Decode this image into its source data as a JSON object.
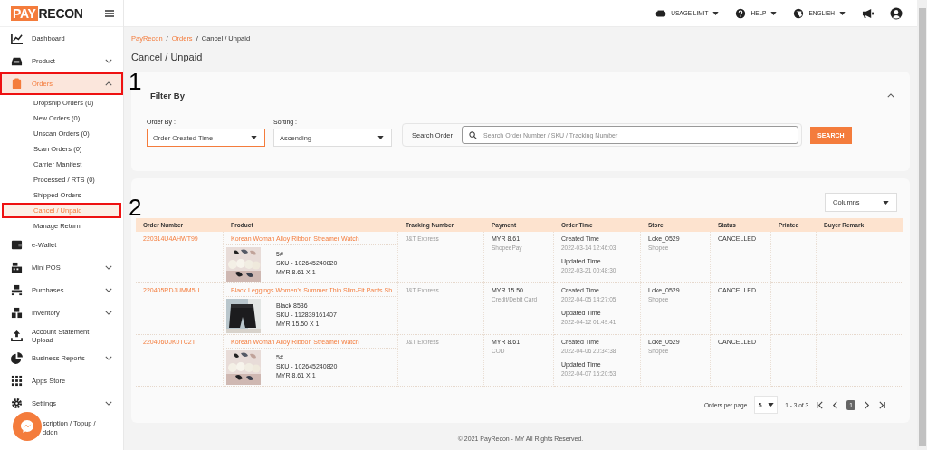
{
  "logo": {
    "part1": "PAY",
    "part2": "RECON"
  },
  "header": {
    "menus": [
      {
        "label": "USAGE LIMIT"
      },
      {
        "label": "HELP"
      },
      {
        "label": "ENGLISH"
      }
    ]
  },
  "sidebar": {
    "items": [
      {
        "label": "Dashboard",
        "selected": false,
        "highlighted": false
      },
      {
        "label": "Product",
        "expanded": false,
        "selected": false,
        "highlighted": false
      },
      {
        "label": "Orders",
        "expanded": true,
        "selected": true,
        "highlighted": true,
        "children": [
          {
            "label": "Dropship Orders (0)",
            "selected": false,
            "highlighted": false
          },
          {
            "label": "New Orders (0)",
            "selected": false,
            "highlighted": false
          },
          {
            "label": "Unscan Orders (0)",
            "selected": false,
            "highlighted": false
          },
          {
            "label": "Scan Orders (0)",
            "selected": false,
            "highlighted": false
          },
          {
            "label": "Carrier Manifest",
            "selected": false,
            "highlighted": false
          },
          {
            "label": "Processed / RTS (0)",
            "selected": false,
            "highlighted": false
          },
          {
            "label": "Shipped Orders",
            "selected": false,
            "highlighted": false
          },
          {
            "label": "Cancel / Unpaid",
            "selected": true,
            "highlighted": true
          },
          {
            "label": "Manage Return",
            "selected": false,
            "highlighted": false
          }
        ]
      },
      {
        "label": "e-Wallet",
        "selected": false,
        "highlighted": false
      },
      {
        "label": "Mini POS",
        "expanded": false,
        "selected": false,
        "highlighted": false
      },
      {
        "label": "Purchases",
        "expanded": false,
        "selected": false,
        "highlighted": false
      },
      {
        "label": "Inventory",
        "expanded": false,
        "selected": false,
        "highlighted": false
      },
      {
        "label": "Account Statement Upload",
        "selected": false,
        "highlighted": false
      },
      {
        "label": "Business Reports",
        "expanded": false,
        "selected": false,
        "highlighted": false
      },
      {
        "label": "Apps Store",
        "selected": false,
        "highlighted": false
      },
      {
        "label": "Settings",
        "expanded": false,
        "selected": false,
        "highlighted": false
      },
      {
        "label": "scription / Topup / ddon",
        "selected": false,
        "highlighted": false
      }
    ]
  },
  "breadcrumb": [
    {
      "label": "PayRecon",
      "kind": "link"
    },
    {
      "label": "/",
      "kind": "separator"
    },
    {
      "label": "Orders",
      "kind": "link"
    },
    {
      "label": "/",
      "kind": "separator"
    },
    {
      "label": "Cancel / Unpaid",
      "kind": "current"
    }
  ],
  "page_title": "Cancel / Unpaid",
  "filter": {
    "annotation": "1",
    "title": "Filter By",
    "order_by": {
      "label": "Order By :",
      "value": "Order Created Time"
    },
    "sorting": {
      "label": "Sorting :",
      "value": "Ascending"
    },
    "search": {
      "label": "Search Order",
      "placeholder": "Search Order Number / SKU / Tracking Number"
    },
    "search_button": "SEARCH"
  },
  "table": {
    "annotation": "2",
    "columns_button": "Columns",
    "columns": [
      "Order Number",
      "Product",
      "Tracking Number",
      "Payment",
      "Order Time",
      "Store",
      "Status",
      "Printed",
      "Buyer Remark"
    ],
    "rows": [
      {
        "order_number": "220314U4AHWT99",
        "product": {
          "title": "Korean Woman Alloy Ribbon Streamer Watch",
          "variant": "5#",
          "sku": "SKU - 102645240820",
          "price": "MYR 8.61 X 1"
        },
        "tracking": "J&T Express",
        "payment": {
          "amount": "MYR 8.61",
          "method": "ShopeePay"
        },
        "order_time": {
          "created_label": "Created Time",
          "created": "2022-03-14 12:46:03",
          "updated_label": "Updated Time",
          "updated": "2022-03-21 00:48:30"
        },
        "store": {
          "name": "Loke_0529",
          "platform": "Shopee"
        },
        "status": "CANCELLED"
      },
      {
        "order_number": "220405RDJUMM5U",
        "product": {
          "title": "Black Leggings Women's Summer Thin Slim-Fit Pants Sh",
          "variant": "Black 8536",
          "sku": "SKU - 112839161407",
          "price": "MYR 15.50 X 1"
        },
        "tracking": "J&T Express",
        "payment": {
          "amount": "MYR 15.50",
          "method": "Credit/Debit Card"
        },
        "order_time": {
          "created_label": "Created Time",
          "created": "2022-04-05 14:27:05",
          "updated_label": "Updated Time",
          "updated": "2022-04-12 01:49:41"
        },
        "store": {
          "name": "Loke_0529",
          "platform": "Shopee"
        },
        "status": "CANCELLED"
      },
      {
        "order_number": "220406UJK0TC2T",
        "product": {
          "title": "Korean Woman Alloy Ribbon Streamer Watch",
          "variant": "5#",
          "sku": "SKU - 102645240820",
          "price": "MYR 8.61 X 1"
        },
        "tracking": "J&T Express",
        "payment": {
          "amount": "MYR 8.61",
          "method": "COD"
        },
        "order_time": {
          "created_label": "Created Time",
          "created": "2022-04-06 20:34:38",
          "updated_label": "Updated Time",
          "updated": "2022-04-07 15:20:53"
        },
        "store": {
          "name": "Loke_0529",
          "platform": "Shopee"
        },
        "status": "CANCELLED"
      }
    ],
    "pagination": {
      "per_page_label": "Orders per page",
      "per_page": "5",
      "range": "1 - 3 of 3",
      "pages": [
        {
          "label": "1",
          "selected": true
        }
      ]
    }
  },
  "footer": "© 2021 PayRecon - MY All Rights Reserved."
}
